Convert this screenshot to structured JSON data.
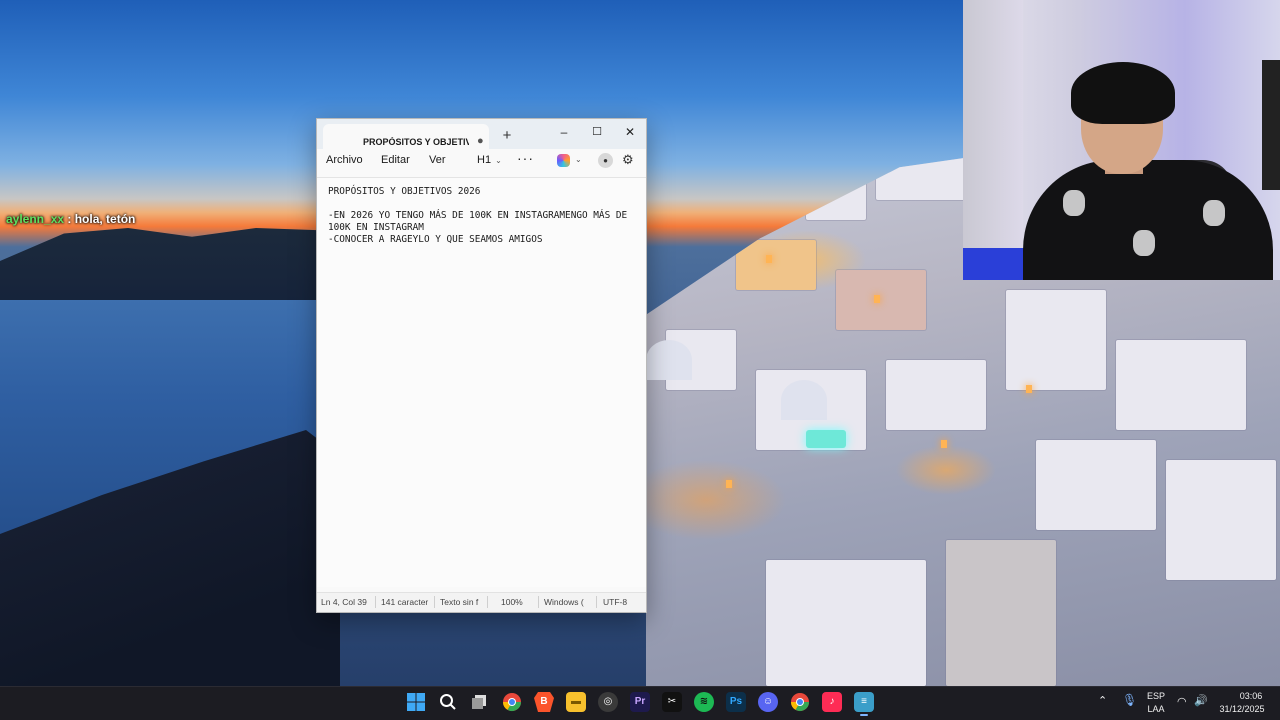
{
  "chat": {
    "username": "aylenn_xx",
    "message": " : hola, tetón"
  },
  "notepad": {
    "tab_title": "PROPÓSITOS Y OBJETIVO",
    "menu": [
      "Archivo",
      "Editar",
      "Ver"
    ],
    "heading_select": "H1",
    "lines": [
      "PROPÓSITOS Y OBJETIVOS 2026",
      "",
      "-EN 2026 YO TENGO MÁS DE 100K EN INSTAGRAMENGO MÁS DE",
      "100K EN INSTAGRAM",
      "-CONOCER A RAGEYLO Y QUE SEAMOS AMIGOS"
    ],
    "status": {
      "position": "Ln 4, Col 39",
      "chars": "141 caracter",
      "format": "Texto sin f",
      "zoom": "100%",
      "line_ending": "Windows (",
      "encoding": "UTF-8"
    }
  },
  "taskbar": {
    "apps": [
      {
        "name": "windows-start",
        "color": "#2fa2f5"
      },
      {
        "name": "search",
        "color": "#1c1c22"
      },
      {
        "name": "task-view",
        "color": "#1c1c22"
      },
      {
        "name": "chrome",
        "color": "#e8483b"
      },
      {
        "name": "brave",
        "color": "#fb542b"
      },
      {
        "name": "file-explorer",
        "color": "#f7c02d"
      },
      {
        "name": "obs",
        "color": "#3a3a3a"
      },
      {
        "name": "premiere-pro",
        "color": "#1e1a4d"
      },
      {
        "name": "capcut",
        "color": "#111111"
      },
      {
        "name": "spotify",
        "color": "#1db954"
      },
      {
        "name": "photoshop",
        "color": "#0c2f4a"
      },
      {
        "name": "discord",
        "color": "#5865f2"
      },
      {
        "name": "chrome-2",
        "color": "#e8483b"
      },
      {
        "name": "tiktok",
        "color": "#fe2c55"
      },
      {
        "name": "notepad",
        "color": "#3b9ec9"
      }
    ],
    "lang_top": "ESP",
    "lang_bottom": "LAA",
    "time": "03:06",
    "date": "31/12/2025"
  }
}
